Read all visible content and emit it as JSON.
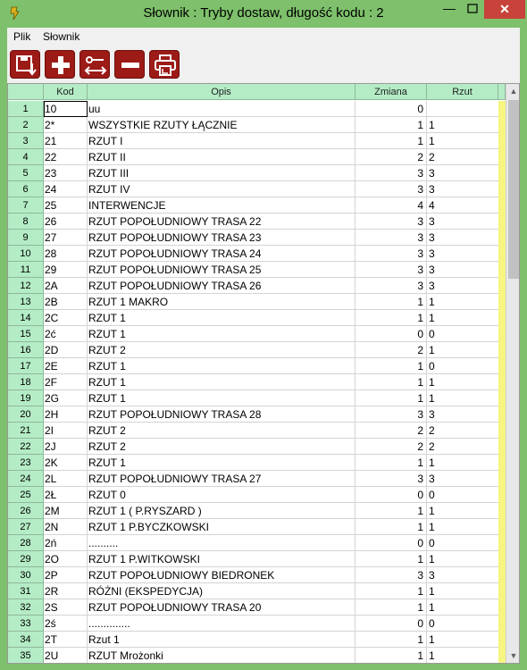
{
  "window": {
    "title": "Słownik : Tryby dostaw,  długość kodu : 2",
    "minimize": "—",
    "close": "✕"
  },
  "menu": {
    "file": "Plik",
    "dictionary": "Słownik"
  },
  "toolbar": {
    "icons": [
      "save-to-icon",
      "add-icon",
      "edit-icon",
      "remove-icon",
      "print-icon"
    ]
  },
  "colors": {
    "accent": "#9c1b17",
    "header": "#b4ecc6",
    "window": "#7ec06b",
    "highlight": "#f6f582"
  },
  "columns": {
    "num": "",
    "kod": "Kod",
    "opis": "Opis",
    "zmiana": "Zmiana",
    "rzut": "Rzut"
  },
  "rows": [
    {
      "n": "1",
      "kod": "10",
      "opis": "uu",
      "zmiana": "0",
      "rzut": ""
    },
    {
      "n": "2",
      "kod": "2*",
      "opis": "WSZYSTKIE RZUTY ŁĄCZNIE",
      "zmiana": "1",
      "rzut": "1"
    },
    {
      "n": "3",
      "kod": "21",
      "opis": "RZUT I",
      "zmiana": "1",
      "rzut": "1"
    },
    {
      "n": "4",
      "kod": "22",
      "opis": "RZUT II",
      "zmiana": "2",
      "rzut": "2"
    },
    {
      "n": "5",
      "kod": "23",
      "opis": "RZUT III",
      "zmiana": "3",
      "rzut": "3"
    },
    {
      "n": "6",
      "kod": "24",
      "opis": "RZUT IV",
      "zmiana": "3",
      "rzut": "3"
    },
    {
      "n": "7",
      "kod": "25",
      "opis": "INTERWENCJE",
      "zmiana": "4",
      "rzut": "4"
    },
    {
      "n": "8",
      "kod": "26",
      "opis": "RZUT POPOŁUDNIOWY TRASA  22",
      "zmiana": "3",
      "rzut": "3"
    },
    {
      "n": "9",
      "kod": "27",
      "opis": "RZUT POPOŁUDNIOWY TRASA 23",
      "zmiana": "3",
      "rzut": "3"
    },
    {
      "n": "10",
      "kod": "28",
      "opis": "RZUT POPOŁUDNIOWY TRASA  24",
      "zmiana": "3",
      "rzut": "3"
    },
    {
      "n": "11",
      "kod": "29",
      "opis": "RZUT POPOŁUDNIOWY TRASA 25",
      "zmiana": "3",
      "rzut": "3"
    },
    {
      "n": "12",
      "kod": "2A",
      "opis": "RZUT POPOŁUDNIOWY TRASA 26",
      "zmiana": "3",
      "rzut": "3"
    },
    {
      "n": "13",
      "kod": "2B",
      "opis": "RZUT 1 MAKRO",
      "zmiana": "1",
      "rzut": "1"
    },
    {
      "n": "14",
      "kod": "2C",
      "opis": "RZUT 1",
      "zmiana": "1",
      "rzut": "1"
    },
    {
      "n": "15",
      "kod": "2ć",
      "opis": "RZUT 1",
      "zmiana": "0",
      "rzut": "0"
    },
    {
      "n": "16",
      "kod": "2D",
      "opis": "RZUT 2",
      "zmiana": "2",
      "rzut": "1"
    },
    {
      "n": "17",
      "kod": "2E",
      "opis": "RZUT 1",
      "zmiana": "1",
      "rzut": "0"
    },
    {
      "n": "18",
      "kod": "2F",
      "opis": "RZUT 1",
      "zmiana": "1",
      "rzut": "1"
    },
    {
      "n": "19",
      "kod": "2G",
      "opis": "RZUT 1",
      "zmiana": "1",
      "rzut": "1"
    },
    {
      "n": "20",
      "kod": "2H",
      "opis": "RZUT POPOŁUDNIOWY TRASA 28",
      "zmiana": "3",
      "rzut": "3"
    },
    {
      "n": "21",
      "kod": "2I",
      "opis": "RZUT 2",
      "zmiana": "2",
      "rzut": "2"
    },
    {
      "n": "22",
      "kod": "2J",
      "opis": "RZUT 2",
      "zmiana": "2",
      "rzut": "2"
    },
    {
      "n": "23",
      "kod": "2K",
      "opis": "RZUT 1",
      "zmiana": "1",
      "rzut": "1"
    },
    {
      "n": "24",
      "kod": "2L",
      "opis": "RZUT POPOŁUDNIOWY TRASA 27",
      "zmiana": "3",
      "rzut": "3"
    },
    {
      "n": "25",
      "kod": "2Ł",
      "opis": "RZUT 0",
      "zmiana": "0",
      "rzut": "0"
    },
    {
      "n": "26",
      "kod": "2M",
      "opis": "RZUT 1 ( P.RYSZARD )",
      "zmiana": "1",
      "rzut": "1"
    },
    {
      "n": "27",
      "kod": "2N",
      "opis": "RZUT 1 P.BYCZKOWSKI",
      "zmiana": "1",
      "rzut": "1"
    },
    {
      "n": "28",
      "kod": "2ń",
      "opis": "..........",
      "zmiana": "0",
      "rzut": "0"
    },
    {
      "n": "29",
      "kod": "2O",
      "opis": "RZUT 1 P.WITKOWSKI",
      "zmiana": "1",
      "rzut": "1"
    },
    {
      "n": "30",
      "kod": "2P",
      "opis": "RZUT POPOŁUDNIOWY BIEDRONEK",
      "zmiana": "3",
      "rzut": "3"
    },
    {
      "n": "31",
      "kod": "2R",
      "opis": "RÓŻNI (EKSPEDYCJA)",
      "zmiana": "1",
      "rzut": "1"
    },
    {
      "n": "32",
      "kod": "2S",
      "opis": "RZUT POPOŁUDNIOWY TRASA 20",
      "zmiana": "1",
      "rzut": "1"
    },
    {
      "n": "33",
      "kod": "2ś",
      "opis": "..............",
      "zmiana": "0",
      "rzut": "0"
    },
    {
      "n": "34",
      "kod": "2T",
      "opis": "Rzut 1",
      "zmiana": "1",
      "rzut": "1"
    },
    {
      "n": "35",
      "kod": "2U",
      "opis": "RZUT Mrożonki",
      "zmiana": "1",
      "rzut": "1"
    }
  ]
}
